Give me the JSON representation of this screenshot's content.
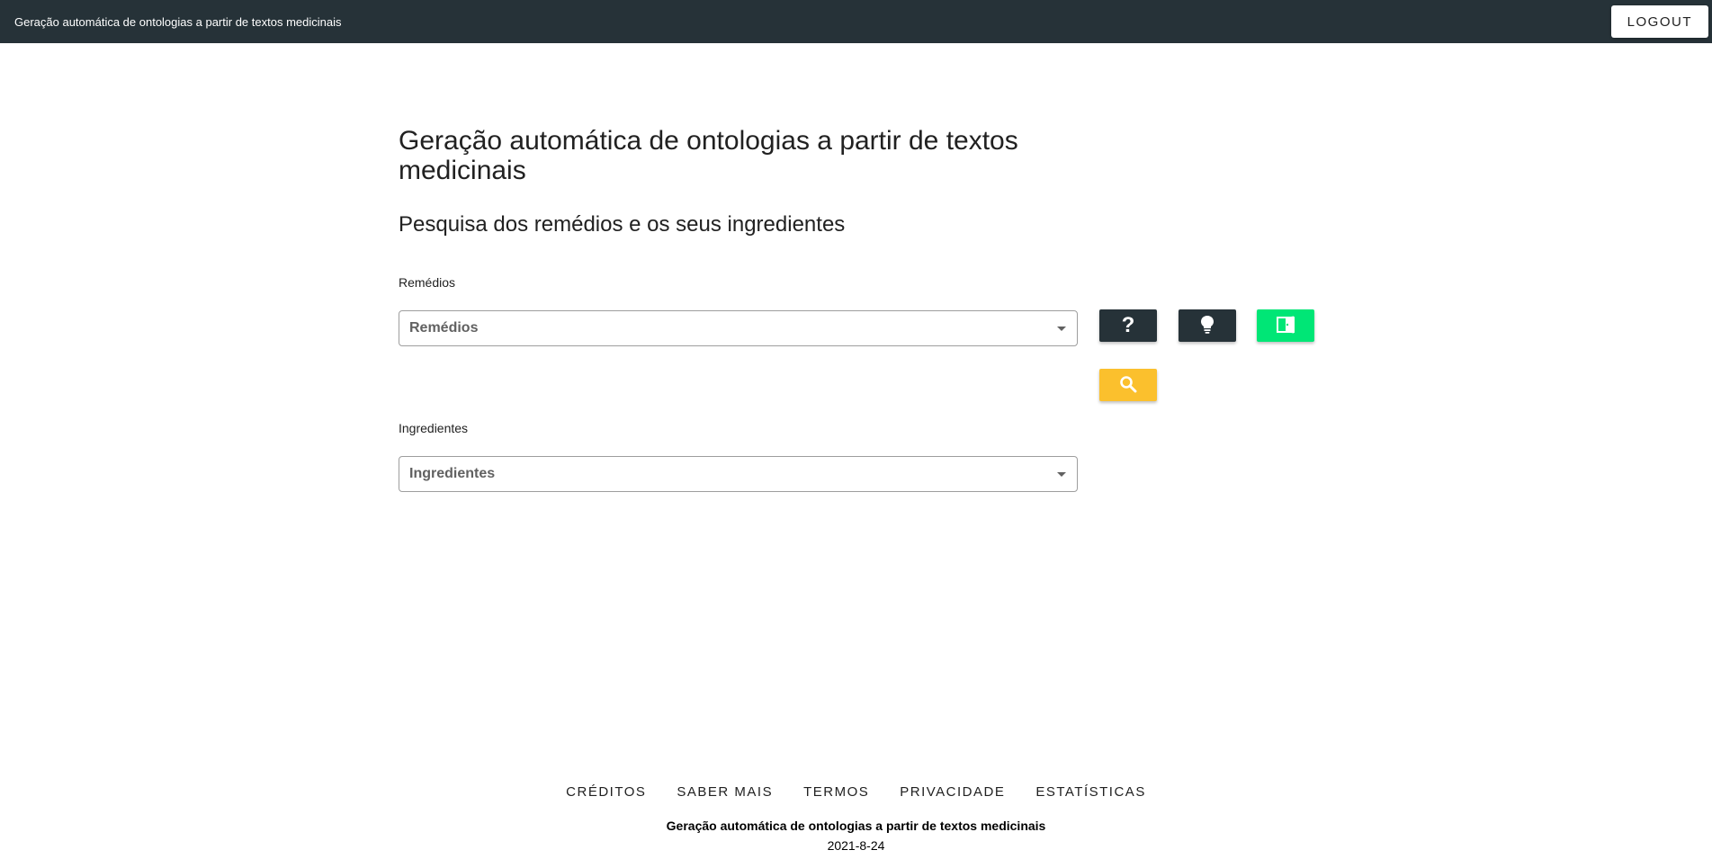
{
  "topbar": {
    "title": "Geração automática de ontologias a partir de textos medicinais",
    "logout_label": "LOGOUT"
  },
  "main": {
    "title": "Geração automática de ontologias a partir de textos medicinais",
    "subtitle": "Pesquisa dos remédios e os seus ingredientes",
    "remedios": {
      "label": "Remédios",
      "selected": "Remédios"
    },
    "ingredientes": {
      "label": "Ingredientes",
      "selected": "Ingredientes"
    }
  },
  "buttons": {
    "help_icon": "question-mark",
    "idea_icon": "lightbulb",
    "exit_icon": "door-exit",
    "search_icon": "magnifier",
    "colors": {
      "dark": "#263238",
      "green": "#00e676",
      "amber": "#fbc02d"
    }
  },
  "footer": {
    "links": [
      "CRÉDITOS",
      "SABER MAIS",
      "TERMOS",
      "PRIVACIDADE",
      "ESTATÍSTICAS"
    ],
    "title": "Geração automática de ontologias a partir de textos medicinais",
    "date": "2021-8-24"
  }
}
